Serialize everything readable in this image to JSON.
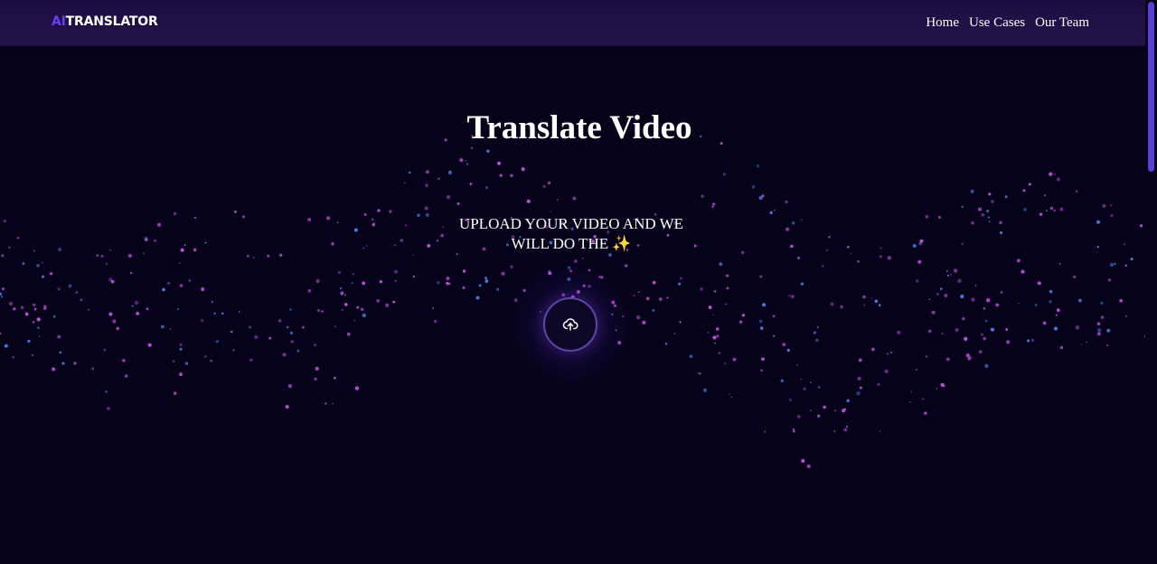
{
  "navbar": {
    "logo_prefix": "AI",
    "logo_word": "TRANSLATOR",
    "links": [
      {
        "label": "Home"
      },
      {
        "label": "Use Cases"
      },
      {
        "label": "Our Team"
      }
    ]
  },
  "hero": {
    "title": "Translate Video",
    "subtitle_line1": "UPLOAD YOUR VIDEO AND WE",
    "subtitle_line2": "WILL DO THE ✨"
  },
  "upload": {
    "icon": "cloud-upload-icon"
  },
  "colors": {
    "background": "#05021a",
    "navbar": "#1d0c40",
    "logo_accent": "#6a3df2",
    "particle_pink": "#c94ee8",
    "particle_blue": "#4d7ee8",
    "scrollbar_thumb": "#5a3fd4"
  }
}
